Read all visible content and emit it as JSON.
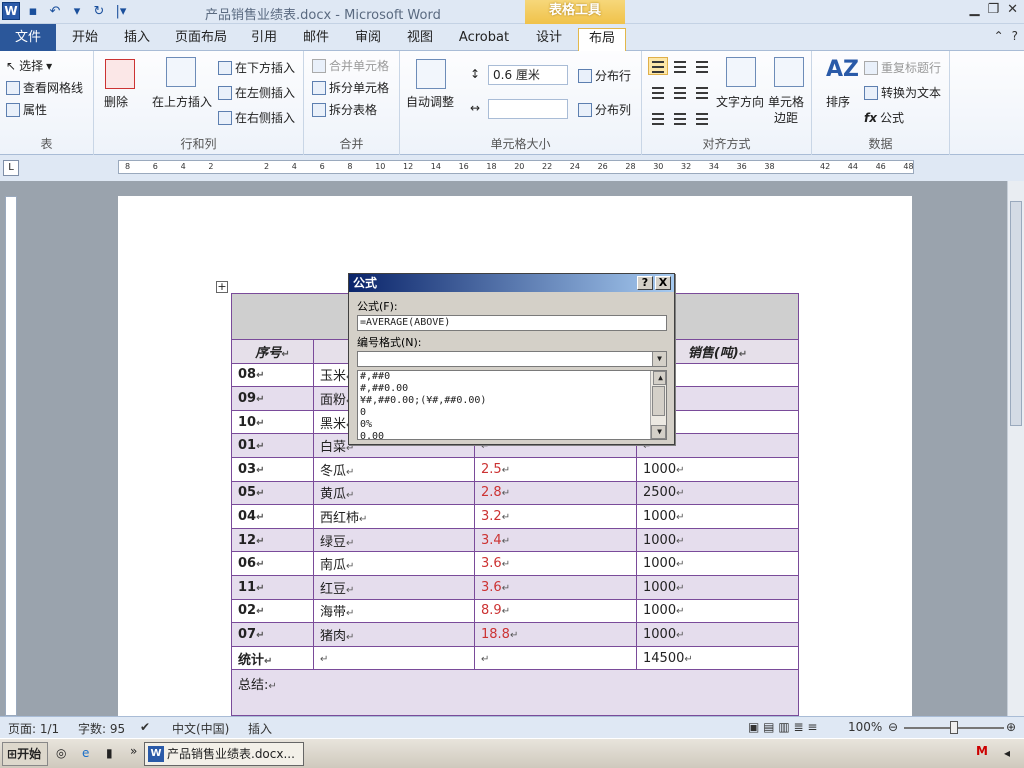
{
  "window": {
    "title": "产品销售业绩表.docx - Microsoft Word",
    "context_tab": "表格工具"
  },
  "tabs": [
    "文件",
    "开始",
    "插入",
    "页面布局",
    "引用",
    "邮件",
    "审阅",
    "视图",
    "Acrobat",
    "设计",
    "布局"
  ],
  "ribbon": {
    "table": {
      "select": "选择",
      "gridlines": "查看网格线",
      "properties": "属性",
      "label": "表"
    },
    "rows_cols": {
      "delete": "删除",
      "insert_above": "在上方插入",
      "insert_below": "在下方插入",
      "insert_left": "在左侧插入",
      "insert_right": "在右侧插入",
      "label": "行和列"
    },
    "merge": {
      "merge_cells": "合并单元格",
      "split_cells": "拆分单元格",
      "split_table": "拆分表格",
      "label": "合并"
    },
    "cell_size": {
      "autofit": "自动调整",
      "height": "0.6 厘米",
      "width": "",
      "dist_rows": "分布行",
      "dist_cols": "分布列",
      "label": "单元格大小"
    },
    "alignment": {
      "text_direction": "文字方向",
      "cell_margins_1": "单元格",
      "cell_margins_2": "边距",
      "label": "对齐方式"
    },
    "data": {
      "sort": "排序",
      "repeat_header": "重复标题行",
      "convert_text": "转换为文本",
      "formula": "公式",
      "label": "数据"
    }
  },
  "ruler_numbers": [
    "8",
    "6",
    "4",
    "2",
    "",
    "2",
    "4",
    "6",
    "8",
    "10",
    "12",
    "14",
    "16",
    "18",
    "20",
    "22",
    "24",
    "26",
    "28",
    "30",
    "32",
    "34",
    "36",
    "38",
    "",
    "42",
    "44",
    "46",
    "48"
  ],
  "table": {
    "headers": [
      "序号",
      "",
      "",
      "销售(吨)"
    ],
    "rows": [
      {
        "no": "08",
        "name": "玉米",
        "price": "",
        "sales": ""
      },
      {
        "no": "09",
        "name": "面粉",
        "price": "",
        "sales": ""
      },
      {
        "no": "10",
        "name": "黑米",
        "price": "",
        "sales": ""
      },
      {
        "no": "01",
        "name": "白菜",
        "price": "",
        "sales": ""
      },
      {
        "no": "03",
        "name": "冬瓜",
        "price": "2.5",
        "sales": "1000"
      },
      {
        "no": "05",
        "name": "黄瓜",
        "price": "2.8",
        "sales": "2500"
      },
      {
        "no": "04",
        "name": "西红柿",
        "price": "3.2",
        "sales": "1000"
      },
      {
        "no": "12",
        "name": "绿豆",
        "price": "3.4",
        "sales": "1000"
      },
      {
        "no": "06",
        "name": "南瓜",
        "price": "3.6",
        "sales": "1000"
      },
      {
        "no": "11",
        "name": "红豆",
        "price": "3.6",
        "sales": "1000"
      },
      {
        "no": "02",
        "name": "海带",
        "price": "8.9",
        "sales": "1000"
      },
      {
        "no": "07",
        "name": "猪肉",
        "price": "18.8",
        "sales": "1000"
      }
    ],
    "total_label": "统计",
    "total_sales": "14500",
    "summary_label": "总结:"
  },
  "dialog": {
    "title": "公式",
    "help": "?",
    "close": "X",
    "formula_label": "公式(F):",
    "formula_value": "=AVERAGE(ABOVE)",
    "format_label": "编号格式(N):",
    "format_value": "",
    "format_options": [
      "#,##0",
      "#,##0.00",
      "¥#,##0.00;(¥#,##0.00)",
      "0",
      "0%",
      "0.00"
    ]
  },
  "statusbar": {
    "page": "页面: 1/1",
    "words": "字数: 95",
    "language": "中文(中国)",
    "mode": "插入",
    "zoom": "100%"
  },
  "taskbar": {
    "start": "开始",
    "item": "产品销售业绩表.docx..."
  }
}
